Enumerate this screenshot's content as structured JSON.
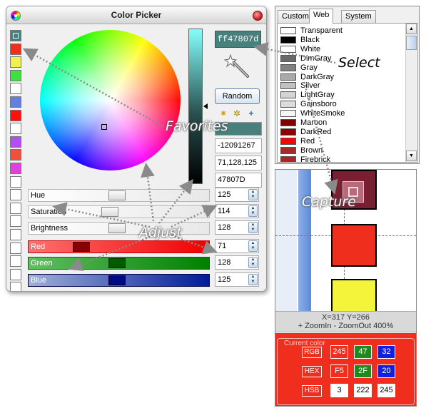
{
  "colors": {
    "current": "#47807d",
    "red_accent": "#f02e1e"
  },
  "picker": {
    "title": "Color Picker",
    "hex": "ff47807d",
    "random_label": "Random",
    "int_value": "-12091267",
    "rgb_value": "71,128,125",
    "hex_value": "47807D",
    "favorites": [
      "#47807d",
      "#f02e1e",
      "#f0f050",
      "#40e040",
      "#ffffff",
      "#6080e0",
      "#ff1010",
      "#ffffff",
      "#b050f0",
      "#f05040",
      "#e040e0",
      "#ffffff",
      "#ffffff",
      "#ffffff",
      "#ffffff",
      "#ffffff",
      "#ffffff",
      "#ffffff",
      "#ffffff",
      "#ffffff"
    ],
    "sliders": [
      {
        "label": "Hue",
        "value": "125"
      },
      {
        "label": "Saturation",
        "value": "114"
      },
      {
        "label": "Brightness",
        "value": "128"
      },
      {
        "label": "Red",
        "value": "71"
      },
      {
        "label": "Green",
        "value": "128"
      },
      {
        "label": "Blue",
        "value": "125"
      }
    ],
    "icons": [
      "color-wheel-icon",
      "close-icon",
      "magic-wand-icon",
      "add-favorite-icon",
      "sort-favorites-icon",
      "plus-icon"
    ]
  },
  "annotations": {
    "favorites": "Favorites",
    "adjust": "Adjust",
    "select": "Select",
    "capture": "Capture"
  },
  "palette": {
    "tabs": [
      "Custom",
      "Web",
      "System"
    ],
    "active_tab": "Web",
    "items": [
      {
        "name": "Transparent",
        "color": "#ffffff"
      },
      {
        "name": "Black",
        "color": "#000000"
      },
      {
        "name": "White",
        "color": "#ffffff"
      },
      {
        "name": "DimGray",
        "color": "#696969"
      },
      {
        "name": "Gray",
        "color": "#808080"
      },
      {
        "name": "DarkGray",
        "color": "#a9a9a9"
      },
      {
        "name": "Silver",
        "color": "#c0c0c0"
      },
      {
        "name": "LightGray",
        "color": "#d3d3d3"
      },
      {
        "name": "Gainsboro",
        "color": "#dcdcdc"
      },
      {
        "name": "WhiteSmoke",
        "color": "#f5f5f5"
      },
      {
        "name": "Maroon",
        "color": "#800000"
      },
      {
        "name": "DarkRed",
        "color": "#8b0000"
      },
      {
        "name": "Red",
        "color": "#ff0000"
      },
      {
        "name": "Brown",
        "color": "#a52a2a"
      },
      {
        "name": "Firebrick",
        "color": "#b22222"
      }
    ]
  },
  "zoom": {
    "coords": "X=317   Y=266",
    "controls": "+ ZoomIn  - ZoomOut   400%",
    "current_title": "Current color",
    "rows": [
      {
        "tag": "RGB",
        "values": [
          "245",
          "47",
          "32"
        ],
        "colors": [
          "#f02e1e",
          "#1e8a1e",
          "#1020e0"
        ]
      },
      {
        "tag": "HEX",
        "values": [
          "F5",
          "2F",
          "20"
        ],
        "colors": [
          "#f02e1e",
          "#1e8a1e",
          "#1020e0"
        ]
      },
      {
        "tag": "HSB",
        "values": [
          "3",
          "222",
          "245"
        ],
        "colors": [
          "#ffffff",
          "#ffffff",
          "#ffffff"
        ]
      }
    ]
  }
}
